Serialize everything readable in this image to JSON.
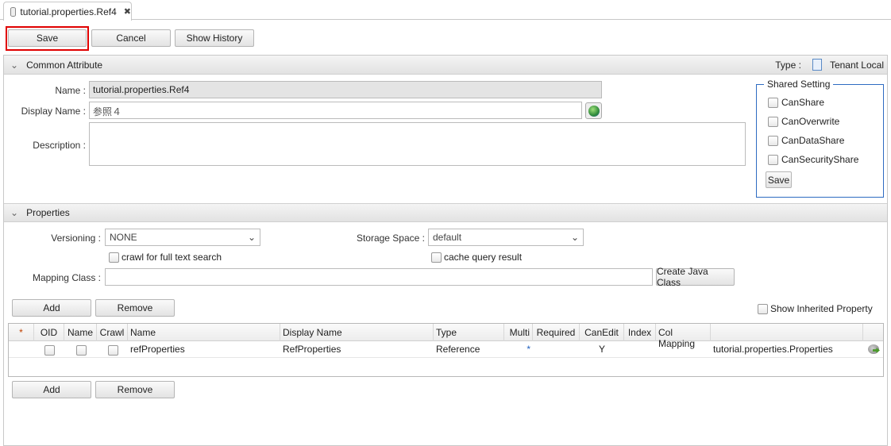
{
  "tab": {
    "title": "tutorial.properties.Ref4",
    "icon": "database-icon",
    "close": "✖"
  },
  "toolbar": {
    "save": "Save",
    "cancel": "Cancel",
    "show_history": "Show History"
  },
  "common": {
    "title": "Common Attribute",
    "type_label": "Type :",
    "type_value": "Tenant Local",
    "name_label": "Name :",
    "name_value": "tutorial.properties.Ref4",
    "display_name_label": "Display Name :",
    "display_name_value": "参照４",
    "description_label": "Description :",
    "description_value": ""
  },
  "shared": {
    "title": "Shared Setting",
    "items": [
      "CanShare",
      "CanOverwrite",
      "CanDataShare",
      "CanSecurityShare"
    ],
    "save": "Save"
  },
  "properties": {
    "title": "Properties",
    "versioning_label": "Versioning :",
    "versioning_value": "NONE",
    "storage_label": "Storage Space :",
    "storage_value": "default",
    "crawl_label": "crawl for full text search",
    "cache_label": "cache query result",
    "mapping_label": "Mapping Class :",
    "mapping_value": "",
    "create_java": "Create Java Class",
    "add": "Add",
    "remove": "Remove",
    "show_inherited": "Show Inherited Property"
  },
  "table": {
    "headers": [
      "*",
      "OID",
      "Name",
      "Crawl",
      "Name",
      "Display Name",
      "Type",
      "Multi",
      "Required",
      "CanEdit",
      "Index",
      "Col Mapping",
      ""
    ],
    "rows": [
      {
        "name": "refProperties",
        "display_name": "RefProperties",
        "type": "Reference",
        "multi": "*",
        "required": "",
        "can_edit": "Y",
        "index": "",
        "col_mapping": "",
        "ref": "tutorial.properties.Properties"
      }
    ]
  },
  "colors": {
    "highlight": "#e00000"
  }
}
